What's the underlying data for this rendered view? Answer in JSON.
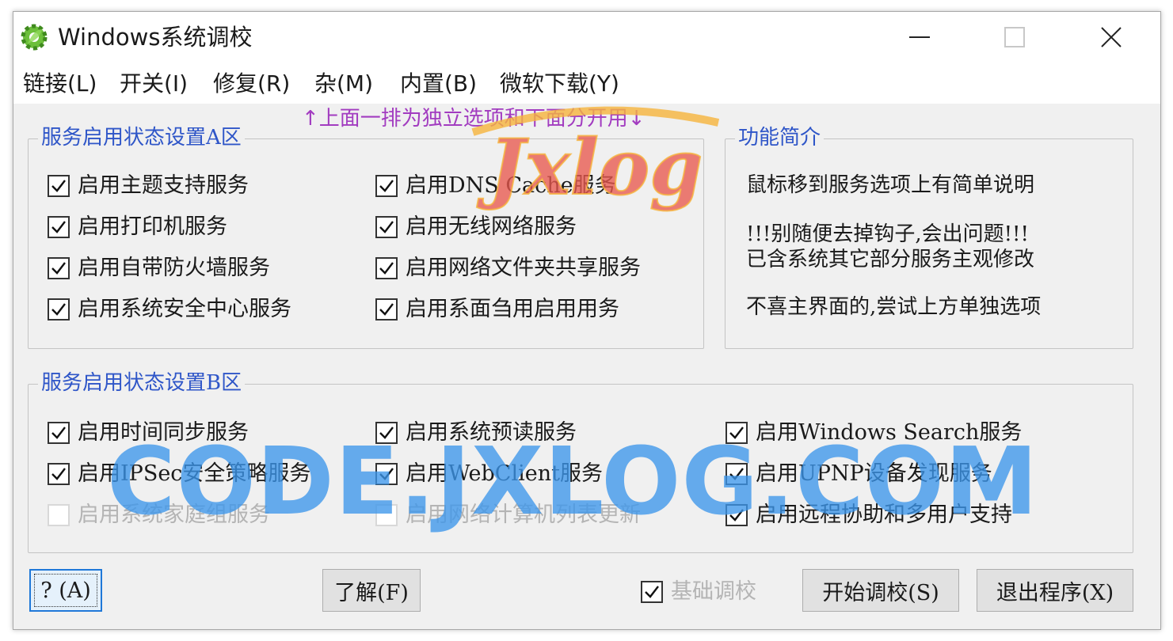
{
  "window": {
    "title": "Windows系统调校",
    "controls": {
      "minimize": "minimize",
      "maximize": "maximize",
      "close": "close"
    }
  },
  "menu": [
    {
      "label": "链接(L)"
    },
    {
      "label": "开关(I)"
    },
    {
      "label": "修复(R)"
    },
    {
      "label": "杂(M)"
    },
    {
      "label": "内置(B)"
    },
    {
      "label": "微软下载(Y)"
    }
  ],
  "hint": "↑上面一排为独立选项和下面分开用↓",
  "groupA": {
    "title": "服务启用状态设置A区",
    "items": [
      {
        "label": "启用主题支持服务",
        "checked": true,
        "enabled": true
      },
      {
        "label": "启用DNS Cache服务",
        "checked": true,
        "enabled": true
      },
      {
        "label": "启用打印机服务",
        "checked": true,
        "enabled": true
      },
      {
        "label": "启用无线网络服务",
        "checked": true,
        "enabled": true
      },
      {
        "label": "启用自带防火墙服务",
        "checked": true,
        "enabled": true
      },
      {
        "label": "启用网络文件夹共享服务",
        "checked": true,
        "enabled": true
      },
      {
        "label": "启用系统安全中心服务",
        "checked": true,
        "enabled": true
      },
      {
        "label": "启用系面刍用启用用务",
        "checked": true,
        "enabled": true
      }
    ]
  },
  "info": {
    "title": "功能简介",
    "lines": [
      "鼠标移到服务选项上有简单说明",
      "!!!别随便去掉钩子,会出问题!!!",
      "已含系统其它部分服务主观修改",
      "不喜主界面的,尝试上方单独选项"
    ]
  },
  "groupB": {
    "title": "服务启用状态设置B区",
    "items": [
      {
        "label": "启用时间同步服务",
        "checked": true,
        "enabled": true
      },
      {
        "label": "启用系统预读服务",
        "checked": true,
        "enabled": true
      },
      {
        "label": "启用Windows Search服务",
        "checked": true,
        "enabled": true
      },
      {
        "label": "启用IPSec安全策略服务",
        "checked": true,
        "enabled": true
      },
      {
        "label": "启用WebClient服务",
        "checked": true,
        "enabled": true
      },
      {
        "label": "启用UPNP设备发现服务",
        "checked": true,
        "enabled": true
      },
      {
        "label": "启用系统家庭组服务",
        "checked": false,
        "enabled": false
      },
      {
        "label": "启用网络计算机列表更新",
        "checked": false,
        "enabled": false
      },
      {
        "label": "启用远程协助和多用户支持",
        "checked": true,
        "enabled": true
      }
    ]
  },
  "bottom": {
    "help_button": "? (A)",
    "understand_button": "了解(F)",
    "basic_tune": {
      "label": "基础调校",
      "checked": true,
      "enabled": false
    },
    "start_button": "开始调校(S)",
    "exit_button": "退出程序(X)"
  },
  "watermarks": {
    "logo": "Jxlog",
    "site": "CODE.JXLOG.COM"
  },
  "colors": {
    "window_bg": "#f0f0f0",
    "group_title": "#2f56c8",
    "hint": "#a23cc0",
    "disabled_text": "#b4b4b4",
    "focus_border": "#1f78d8"
  }
}
